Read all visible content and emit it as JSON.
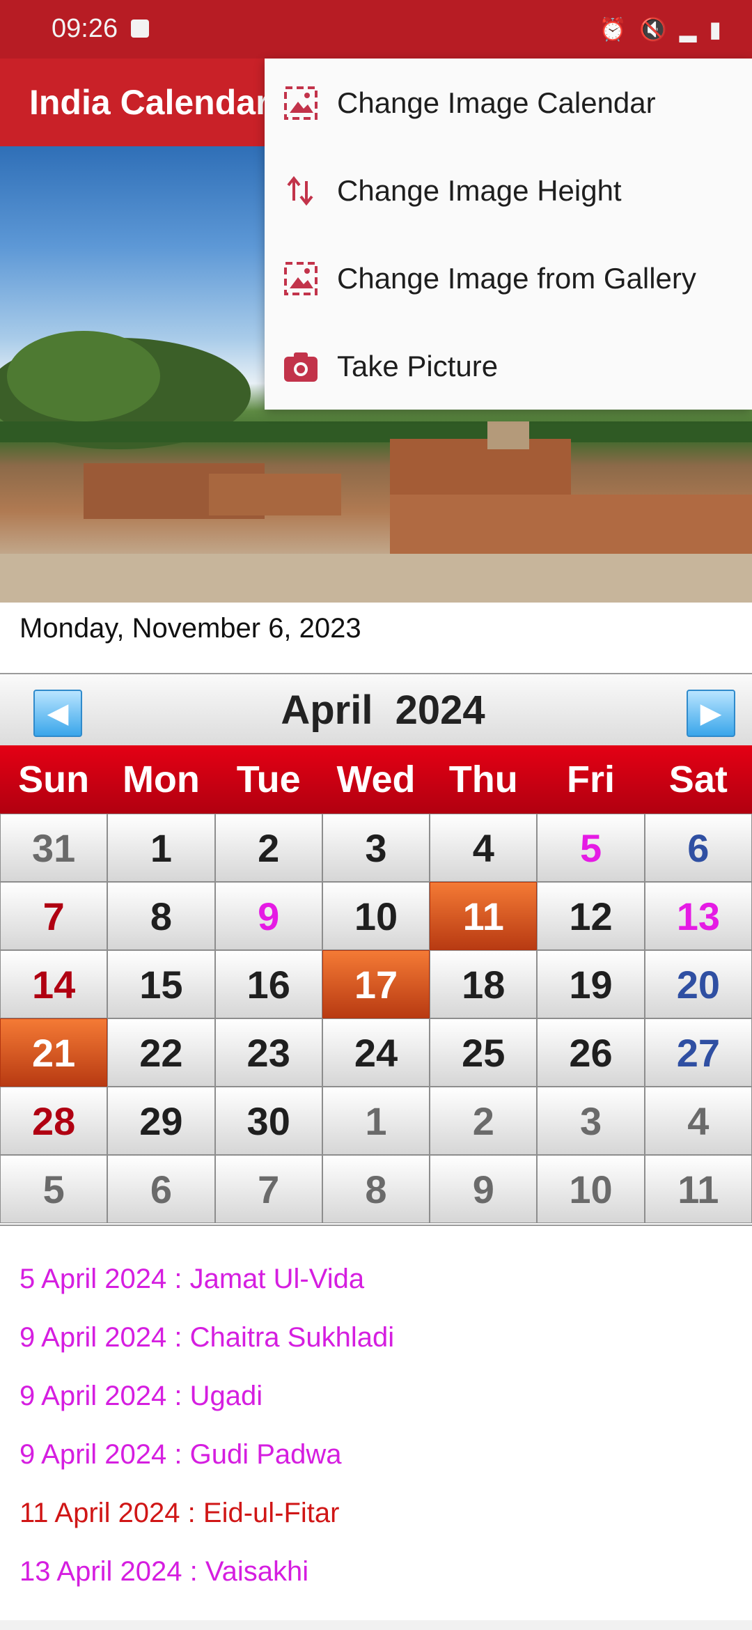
{
  "status_bar": {
    "time": "09:26"
  },
  "app_bar": {
    "title": "India Calendar"
  },
  "date_text": "Monday, November 6, 2023",
  "calendar": {
    "month_label": "April  2024",
    "weekdays": [
      "Sun",
      "Mon",
      "Tue",
      "Wed",
      "Thu",
      "Fri",
      "Sat"
    ],
    "days": [
      [
        "31",
        "1",
        "2",
        "3",
        "4",
        "5",
        "6"
      ],
      [
        "7",
        "8",
        "9",
        "10",
        "11",
        "12",
        "13"
      ],
      [
        "14",
        "15",
        "16",
        "17",
        "18",
        "19",
        "20"
      ],
      [
        "21",
        "22",
        "23",
        "24",
        "25",
        "26",
        "27"
      ],
      [
        "28",
        "29",
        "30",
        "1",
        "2",
        "3",
        "4"
      ],
      [
        "5",
        "6",
        "7",
        "8",
        "9",
        "10",
        "11"
      ]
    ]
  },
  "events": [
    {
      "text": "5 April 2024 : Jamat Ul-Vida",
      "color": "#d51ee0"
    },
    {
      "text": "9 April 2024 : Chaitra Sukhladi",
      "color": "#d51ee0"
    },
    {
      "text": "9 April 2024 : Ugadi",
      "color": "#d51ee0"
    },
    {
      "text": "9 April 2024 : Gudi Padwa",
      "color": "#d51ee0"
    },
    {
      "text": "11 April 2024 : Eid-ul-Fitar",
      "color": "#d01616"
    },
    {
      "text": "13 April 2024 : Vaisakhi",
      "color": "#d51ee0"
    }
  ],
  "menu": {
    "items": [
      {
        "label": "Change Image Calendar",
        "icon": "image-icon"
      },
      {
        "label": "Change Image Height",
        "icon": "swap-vertical-icon"
      },
      {
        "label": "Change Image from Gallery",
        "icon": "gallery-icon"
      },
      {
        "label": "Take Picture",
        "icon": "camera-icon"
      }
    ]
  },
  "colors": {
    "appbar": "#c92128",
    "highlight": "#e0581f",
    "festival": "#e51be4"
  }
}
